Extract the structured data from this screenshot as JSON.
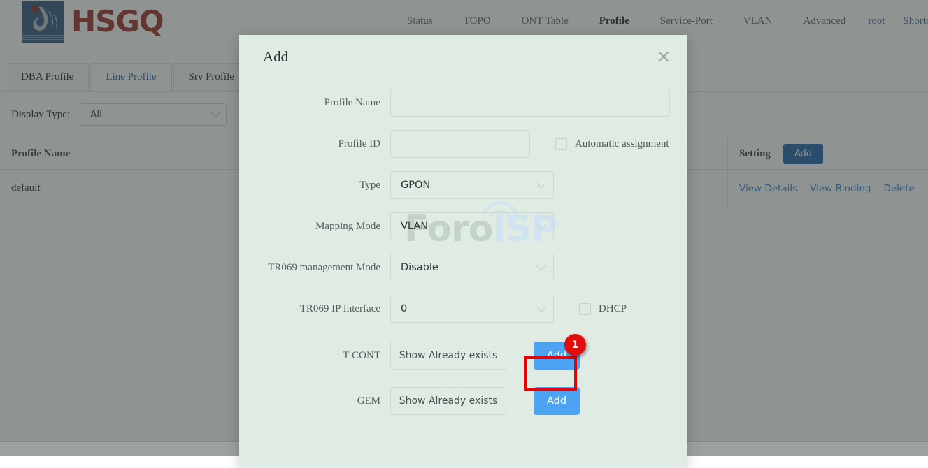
{
  "brand": {
    "name": "HSGQ",
    "logo_icon": "hsgq-logo-icon"
  },
  "nav": {
    "items": [
      {
        "label": "Status",
        "active": false
      },
      {
        "label": "TOPO",
        "active": false
      },
      {
        "label": "ONT Table",
        "active": false
      },
      {
        "label": "Profile",
        "active": true
      },
      {
        "label": "Service-Port",
        "active": false
      },
      {
        "label": "VLAN",
        "active": false
      },
      {
        "label": "Advanced",
        "active": false
      }
    ],
    "user": "root",
    "shortcut": "Shortcut",
    "shortcut_icon": "chevron-down-icon"
  },
  "tabs": [
    {
      "label": "DBA Profile",
      "active": false
    },
    {
      "label": "Line Profile",
      "active": true
    },
    {
      "label": "Srv Profile",
      "active": false
    }
  ],
  "filter": {
    "label": "Display Type:",
    "value": "All",
    "caret_icon": "chevron-down-icon"
  },
  "table": {
    "headers": {
      "profile_name": "Profile Name",
      "setting": "Setting"
    },
    "add_label": "Add",
    "rows": [
      {
        "profile_name": "default",
        "actions": [
          "View Details",
          "View Binding",
          "Delete"
        ]
      }
    ]
  },
  "watermark": {
    "part_a": "Foro",
    "part_b": "ISP",
    "arc_icon": "wifi-arc-icon"
  },
  "modal": {
    "title": "Add",
    "close_icon": "close-icon",
    "fields": {
      "profile_name": {
        "label": "Profile Name",
        "value": "",
        "placeholder": ""
      },
      "profile_id": {
        "label": "Profile ID",
        "value": "",
        "placeholder": ""
      },
      "automatic_assignment": {
        "label": "Automatic assignment",
        "checked": false
      },
      "type": {
        "label": "Type",
        "value": "GPON",
        "caret_icon": "chevron-down-icon"
      },
      "mapping_mode": {
        "label": "Mapping Mode",
        "value": "VLAN",
        "caret_icon": "chevron-down-icon"
      },
      "tr069_management_mode": {
        "label": "TR069 management Mode",
        "value": "Disable",
        "caret_icon": "chevron-down-icon"
      },
      "tr069_ip_interface": {
        "label": "TR069 IP Interface",
        "value": "0",
        "caret_icon": "chevron-down-icon"
      },
      "dhcp": {
        "label": "DHCP",
        "checked": false
      },
      "tcont": {
        "label": "T-CONT",
        "show_label": "Show Already exists",
        "add_label": "Add"
      },
      "gem": {
        "label": "GEM",
        "show_label": "Show Already exists",
        "add_label": "Add"
      }
    }
  },
  "annotation": {
    "badge_number": "1",
    "highlight_color": "#ef0000",
    "badge_color": "#e00d0d"
  }
}
